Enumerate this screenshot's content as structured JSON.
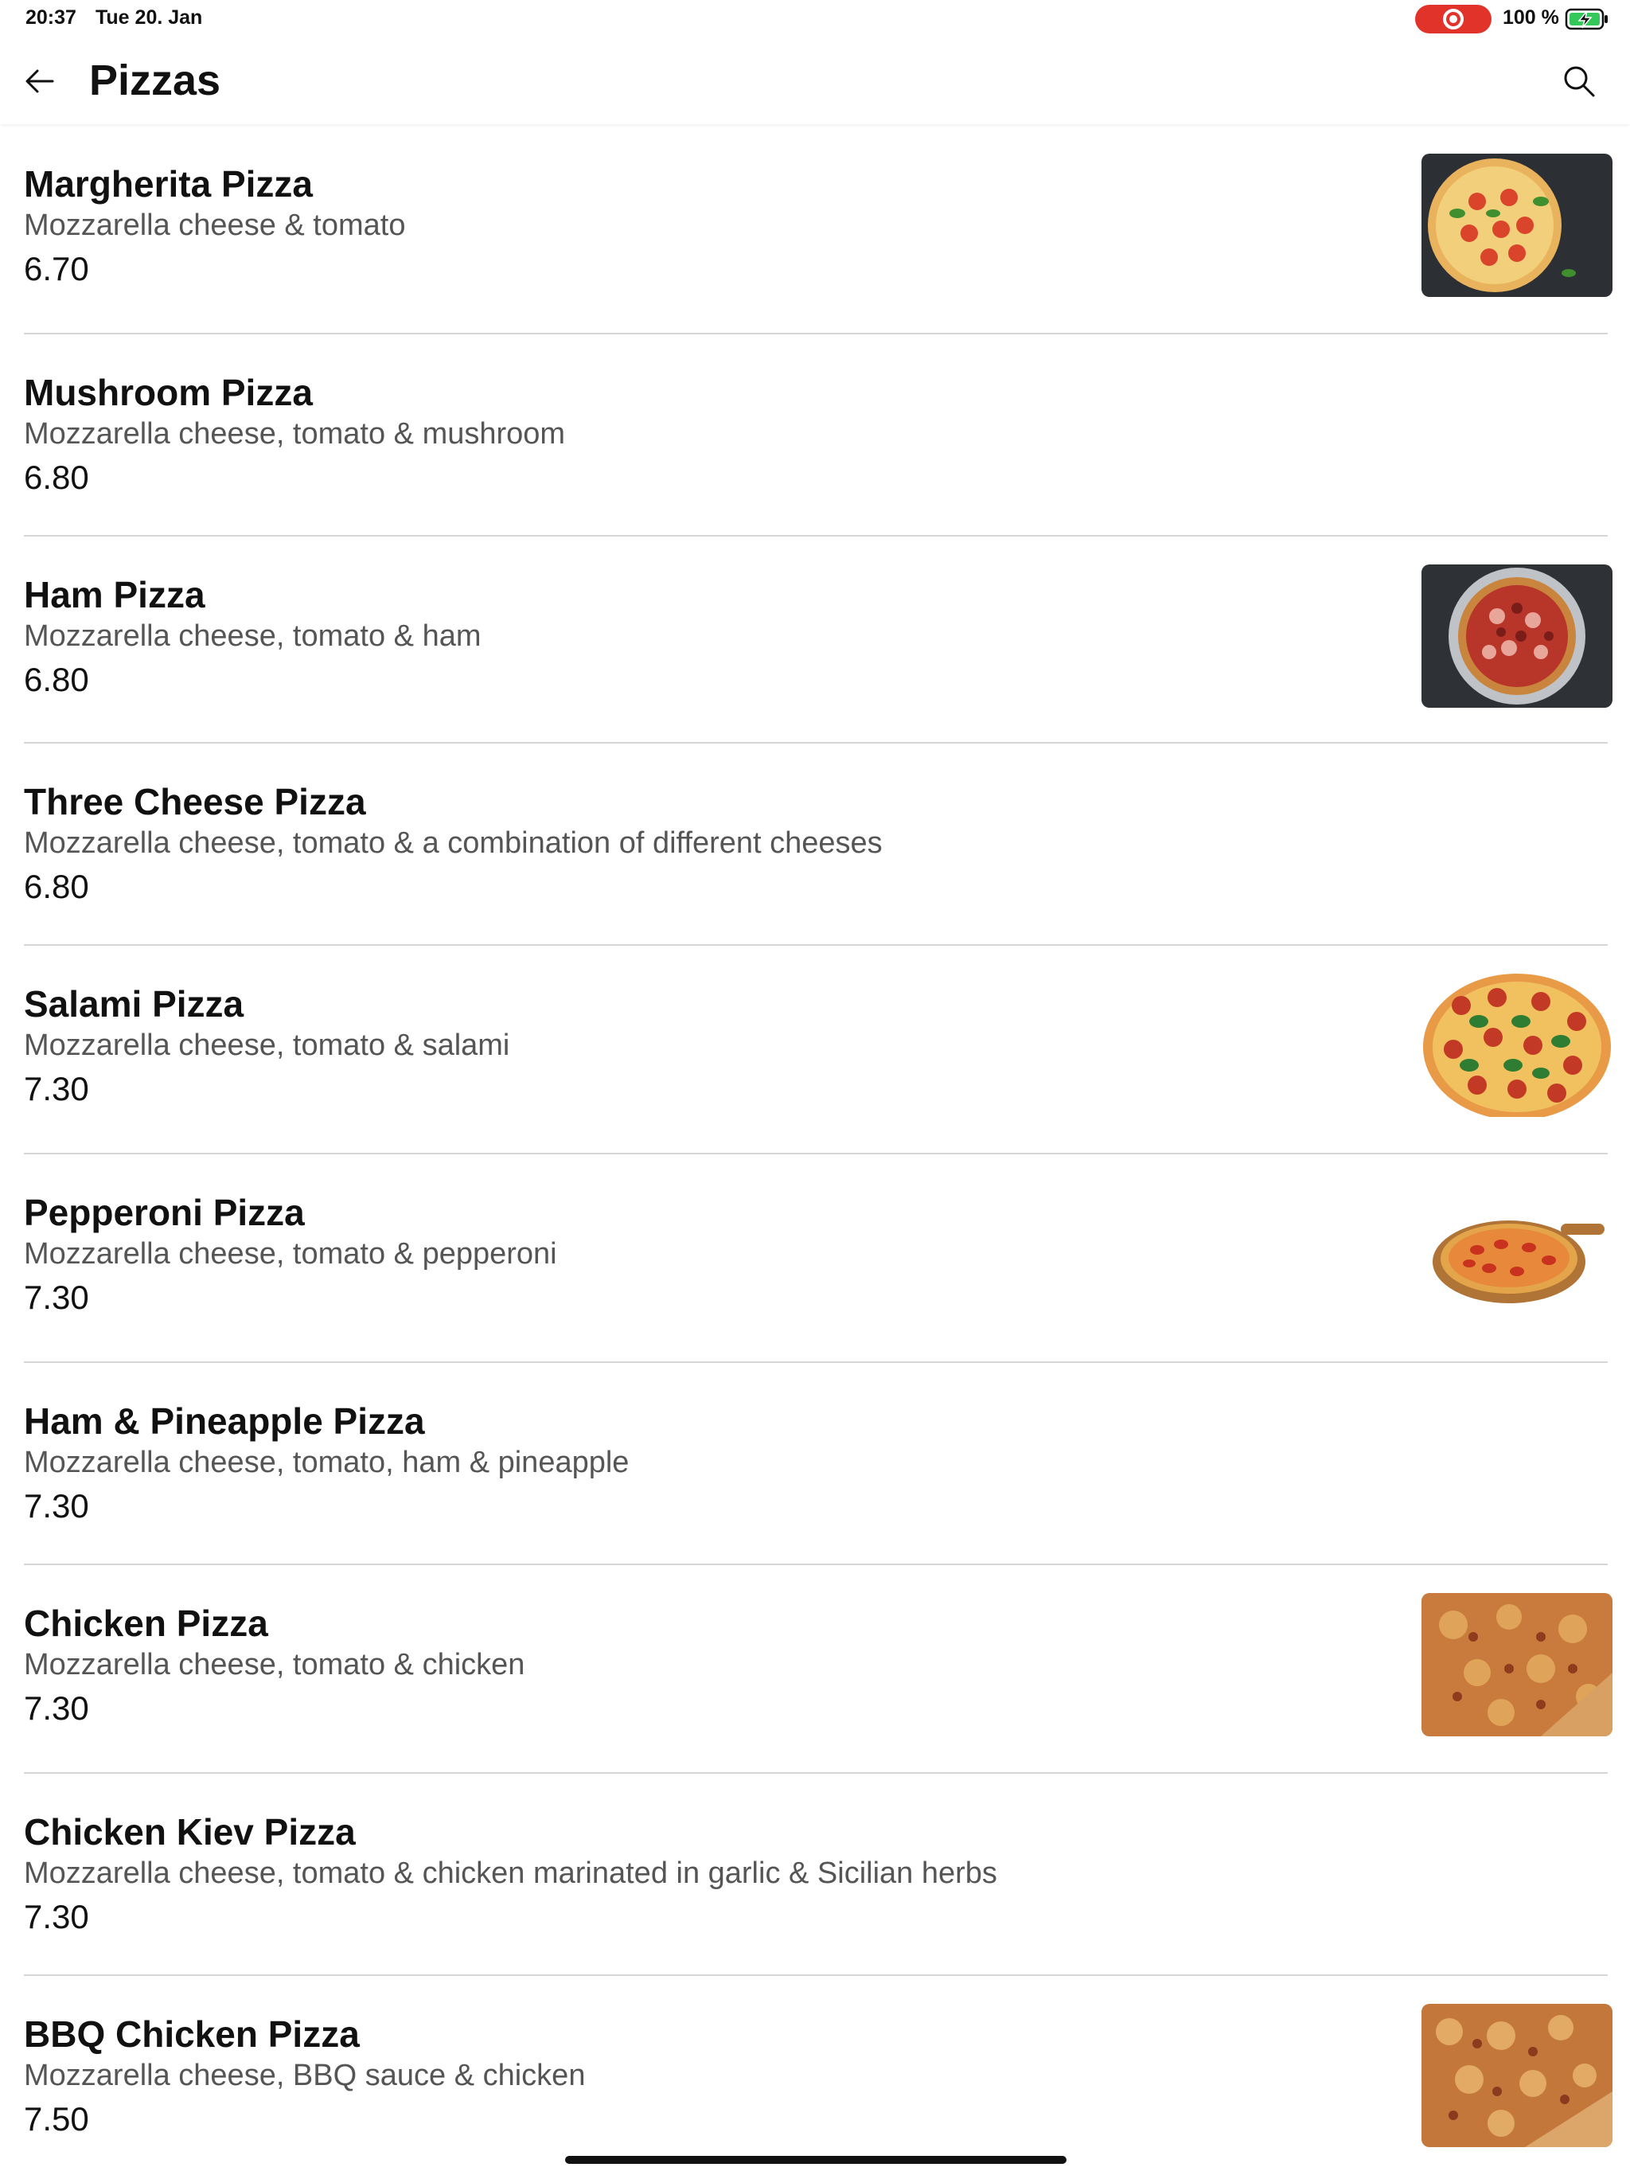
{
  "status_bar": {
    "time": "20:37",
    "date": "Tue 20. Jan",
    "battery_percent": "100 %",
    "recording_color": "#e2332b",
    "battery_color": "#34c759"
  },
  "header": {
    "title": "Pizzas",
    "back_icon": "arrow-left-icon",
    "search_icon": "search-icon"
  },
  "items": [
    {
      "name": "Margherita Pizza",
      "description": "Mozzarella cheese & tomato",
      "price": "6.70",
      "has_image": true
    },
    {
      "name": "Mushroom Pizza",
      "description": "Mozzarella cheese, tomato & mushroom",
      "price": "6.80",
      "has_image": false
    },
    {
      "name": "Ham Pizza",
      "description": "Mozzarella cheese, tomato & ham",
      "price": "6.80",
      "has_image": true
    },
    {
      "name": "Three Cheese Pizza",
      "description": "Mozzarella cheese, tomato & a combination of different cheeses",
      "price": "6.80",
      "has_image": false
    },
    {
      "name": "Salami Pizza",
      "description": "Mozzarella cheese, tomato & salami",
      "price": "7.30",
      "has_image": true
    },
    {
      "name": "Pepperoni Pizza",
      "description": "Mozzarella cheese, tomato & pepperoni",
      "price": "7.30",
      "has_image": true
    },
    {
      "name": "Ham & Pineapple Pizza",
      "description": "Mozzarella cheese, tomato, ham & pineapple",
      "price": "7.30",
      "has_image": false
    },
    {
      "name": "Chicken Pizza",
      "description": "Mozzarella cheese, tomato & chicken",
      "price": "7.30",
      "has_image": true
    },
    {
      "name": "Chicken Kiev Pizza",
      "description": "Mozzarella cheese, tomato & chicken marinated in garlic & Sicilian herbs",
      "price": "7.30",
      "has_image": false
    },
    {
      "name": "BBQ Chicken Pizza",
      "description": "Mozzarella cheese, BBQ sauce & chicken",
      "price": "7.50",
      "has_image": true
    }
  ]
}
